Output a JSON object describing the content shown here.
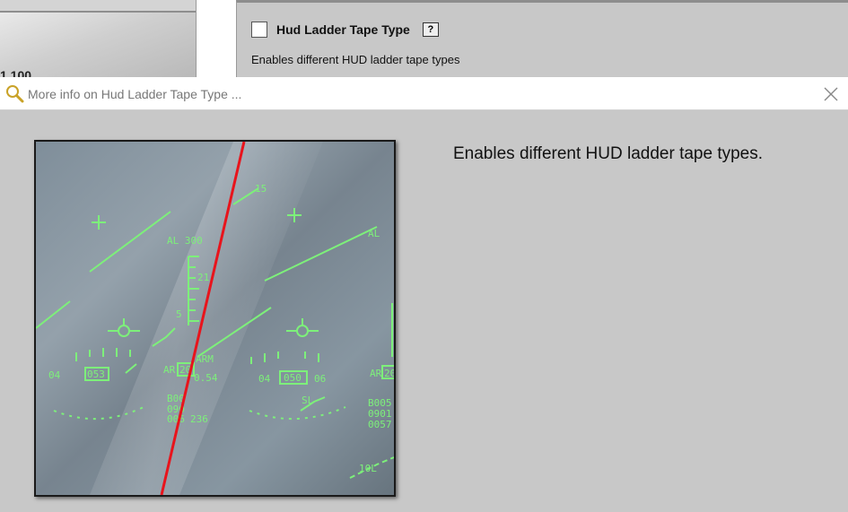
{
  "background_option": {
    "partial_label": "1 100",
    "title": "Hud Ladder Tape Type",
    "help_label": "?",
    "description": "Enables different HUD ladder tape types",
    "checked": false
  },
  "popup": {
    "title": "More info on Hud Ladder Tape Type ...",
    "description": "Enables different HUD ladder tape types.",
    "hud_image": {
      "labels": {
        "alt_left": "AL 300",
        "alt_right": "AL",
        "heading_left_1": "04",
        "heading_left_box": "053",
        "heading_right_1": "04",
        "heading_right_box": "050",
        "heading_right_2": "06",
        "ar_left": "AR",
        "ar_box": "20",
        "arm": "ARM",
        "val_54": "0.54",
        "b00": "B00",
        "v090": "090",
        "v006": "006",
        "v236": "236",
        "ar_right": "AR",
        "ar_right_box": "20",
        "b005": "B005",
        "v0901": "0901",
        "v0057": "0057",
        "v21": "21",
        "v5": "5",
        "v15": "15",
        "sl": "SL",
        "v10l": "10L"
      }
    }
  },
  "colors": {
    "hud_green": "#7df07a",
    "cursor_red": "#e8141c",
    "panel_bg": "#c8c8c8"
  },
  "icons": {
    "magnifier": "magnifier-icon",
    "close": "close-icon"
  }
}
